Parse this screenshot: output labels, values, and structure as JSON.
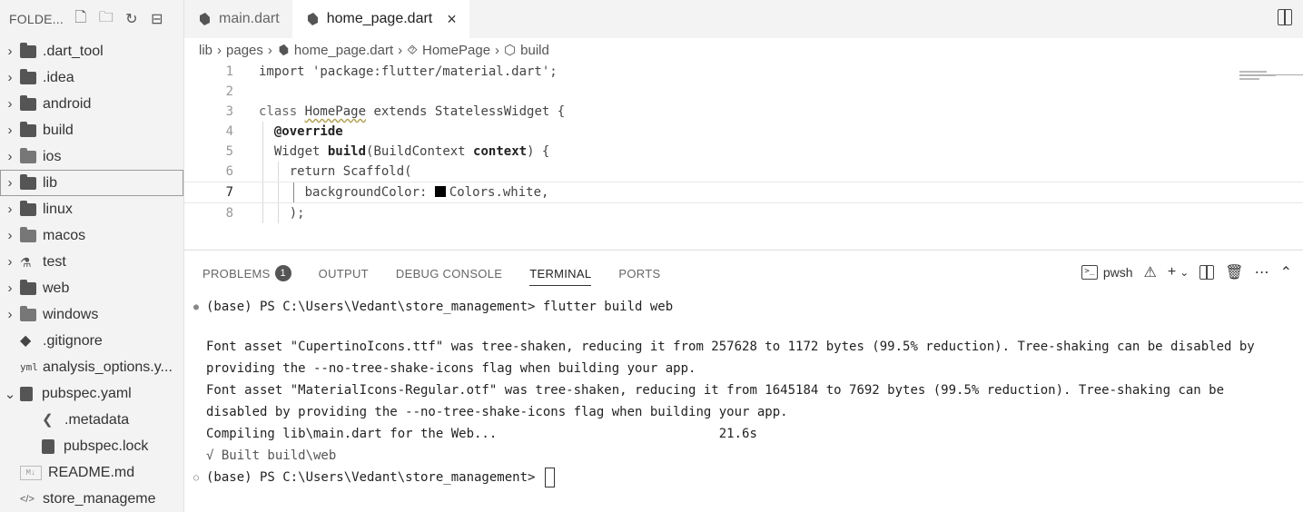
{
  "explorer": {
    "title": "FOLDE...",
    "items": [
      {
        "label": ".dart_tool",
        "type": "folder",
        "expanded": false
      },
      {
        "label": ".idea",
        "type": "folder",
        "expanded": false
      },
      {
        "label": "android",
        "type": "folder",
        "expanded": false
      },
      {
        "label": "build",
        "type": "folder",
        "expanded": false
      },
      {
        "label": "ios",
        "type": "folder",
        "expanded": false
      },
      {
        "label": "lib",
        "type": "folder",
        "expanded": false,
        "selected": true
      },
      {
        "label": "linux",
        "type": "folder",
        "expanded": false
      },
      {
        "label": "macos",
        "type": "folder",
        "expanded": false
      },
      {
        "label": "test",
        "type": "folder",
        "expanded": false
      },
      {
        "label": "web",
        "type": "folder",
        "expanded": false
      },
      {
        "label": "windows",
        "type": "folder",
        "expanded": false
      },
      {
        "label": ".gitignore",
        "type": "file"
      },
      {
        "label": "analysis_options.y...",
        "type": "file"
      },
      {
        "label": "pubspec.yaml",
        "type": "file",
        "expanded": true
      },
      {
        "label": ".metadata",
        "type": "file",
        "nested": true
      },
      {
        "label": "pubspec.lock",
        "type": "file",
        "nested": true
      },
      {
        "label": "README.md",
        "type": "file"
      },
      {
        "label": "store_manageme",
        "type": "file"
      }
    ]
  },
  "tabs": [
    {
      "label": "main.dart",
      "active": false
    },
    {
      "label": "home_page.dart",
      "active": true,
      "close": "×"
    }
  ],
  "breadcrumb": [
    "lib",
    "pages",
    "home_page.dart",
    "HomePage",
    "build"
  ],
  "code": {
    "line_numbers": [
      "1",
      "2",
      "3",
      "4",
      "5",
      "6",
      "7",
      "8"
    ],
    "l1": "import 'package:flutter/material.dart';",
    "l3_kw": "class ",
    "l3_name": "HomePage",
    "l3_rest": " extends StatelessWidget {",
    "l4": "@override",
    "l5_a": "Widget ",
    "l5_b": "build",
    "l5_c": "(BuildContext ",
    "l5_d": "context",
    "l5_e": ") {",
    "l6": "return Scaffold(",
    "l7_a": "backgroundColor: ",
    "l7_b": "Colors.white,",
    "l8": ");"
  },
  "panel": {
    "tabs": [
      "PROBLEMS",
      "OUTPUT",
      "DEBUG CONSOLE",
      "TERMINAL",
      "PORTS"
    ],
    "problems_count": "1",
    "active_tab": "TERMINAL",
    "shell": "pwsh"
  },
  "terminal": {
    "cmd1": "(base) PS C:\\Users\\Vedant\\store_management> flutter build web",
    "out1": "Font asset \"CupertinoIcons.ttf\" was tree-shaken, reducing it from 257628 to 1172 bytes (99.5% reduction). Tree-shaking can be disabled by",
    "out2": "providing the --no-tree-shake-icons flag when building your app.",
    "out3": "Font asset \"MaterialIcons-Regular.otf\" was tree-shaken, reducing it from 1645184 to 7692 bytes (99.5% reduction). Tree-shaking can be",
    "out4": "disabled by providing the --no-tree-shake-icons flag when building your app.",
    "out5": "Compiling lib\\main.dart for the Web...                             21.6s",
    "out6": "√ Built build\\web",
    "prompt": "(base) PS C:\\Users\\Vedant\\store_management> "
  },
  "colors": {
    "accent": "#333333",
    "background": "#ffffff",
    "sidebar": "#f3f3f3"
  }
}
